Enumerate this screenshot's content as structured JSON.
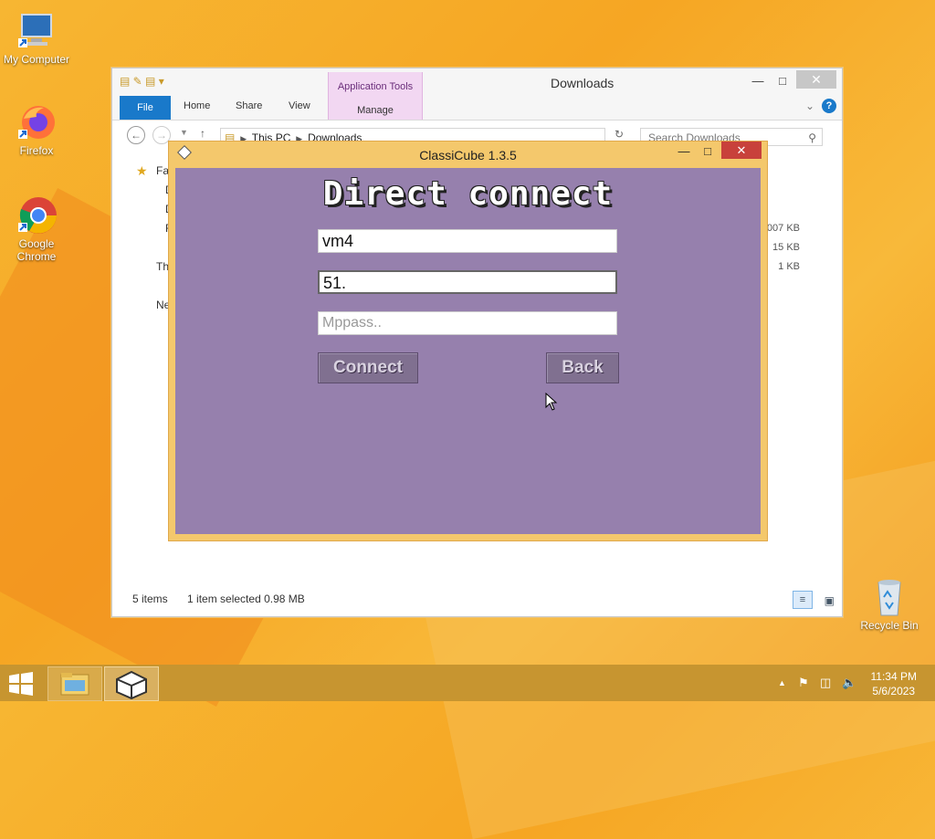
{
  "desktop": {
    "icons": [
      {
        "label": "My Computer",
        "icon": "computer-icon"
      },
      {
        "label": "Firefox",
        "icon": "firefox-icon"
      },
      {
        "label": "Google Chrome",
        "icon": "chrome-icon"
      },
      {
        "label": "Recycle Bin",
        "icon": "recycle-bin-icon"
      }
    ]
  },
  "explorer": {
    "title": "Downloads",
    "ribbon": {
      "file": "File",
      "home": "Home",
      "share": "Share",
      "view": "View",
      "app_tools": "Application Tools",
      "manage": "Manage"
    },
    "address": {
      "crumb1": "This PC",
      "crumb2": "Downloads"
    },
    "search_placeholder": "Search Downloads",
    "nav": {
      "fav": "Fa",
      "d1": "D",
      "d2": "D",
      "f": "F",
      "this": "Th",
      "net": "Ne"
    },
    "sizes": [
      "007 KB",
      "15 KB",
      "1 KB"
    ],
    "status": {
      "items": "5 items",
      "selected": "1 item selected  0.98 MB"
    }
  },
  "classicube": {
    "title": "ClassiCube 1.3.5",
    "heading": "Direct connect",
    "username": "vm4",
    "ip": "51.",
    "mppass_placeholder": "Mppass..",
    "connect": "Connect",
    "back": "Back"
  },
  "taskbar": {
    "time": "11:34 PM",
    "date": "5/6/2023"
  }
}
